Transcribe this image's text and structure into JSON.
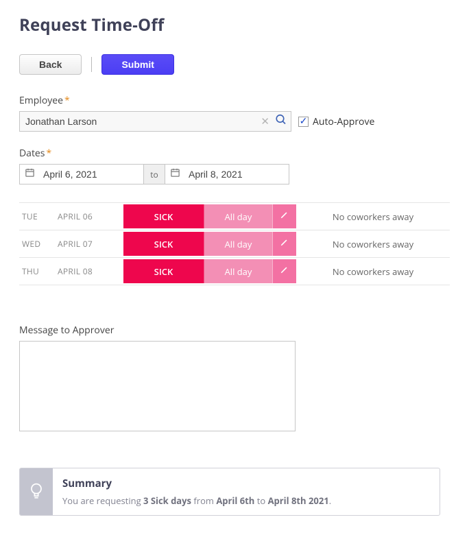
{
  "page_title": "Request Time-Off",
  "actions": {
    "back_label": "Back",
    "submit_label": "Submit"
  },
  "employee": {
    "label": "Employee",
    "value": "Jonathan Larson"
  },
  "auto_approve": {
    "label": "Auto-Approve",
    "checked": true
  },
  "dates": {
    "label": "Dates",
    "from": "April 6, 2021",
    "to_label": "to",
    "to": "April 8, 2021"
  },
  "days": [
    {
      "dow": "TUE",
      "date": "APRIL 06",
      "type": "SICK",
      "span": "All day",
      "coworkers": "No coworkers away"
    },
    {
      "dow": "WED",
      "date": "APRIL 07",
      "type": "SICK",
      "span": "All day",
      "coworkers": "No coworkers away"
    },
    {
      "dow": "THU",
      "date": "APRIL 08",
      "type": "SICK",
      "span": "All day",
      "coworkers": "No coworkers away"
    }
  ],
  "message": {
    "label": "Message to Approver",
    "value": ""
  },
  "summary": {
    "title": "Summary",
    "prefix": "You are requesting ",
    "count_phrase": "3 Sick days",
    "mid1": " from ",
    "from_bold": "April 6th",
    "mid2": " to ",
    "to_bold": "April 8th 2021",
    "suffix": "."
  }
}
